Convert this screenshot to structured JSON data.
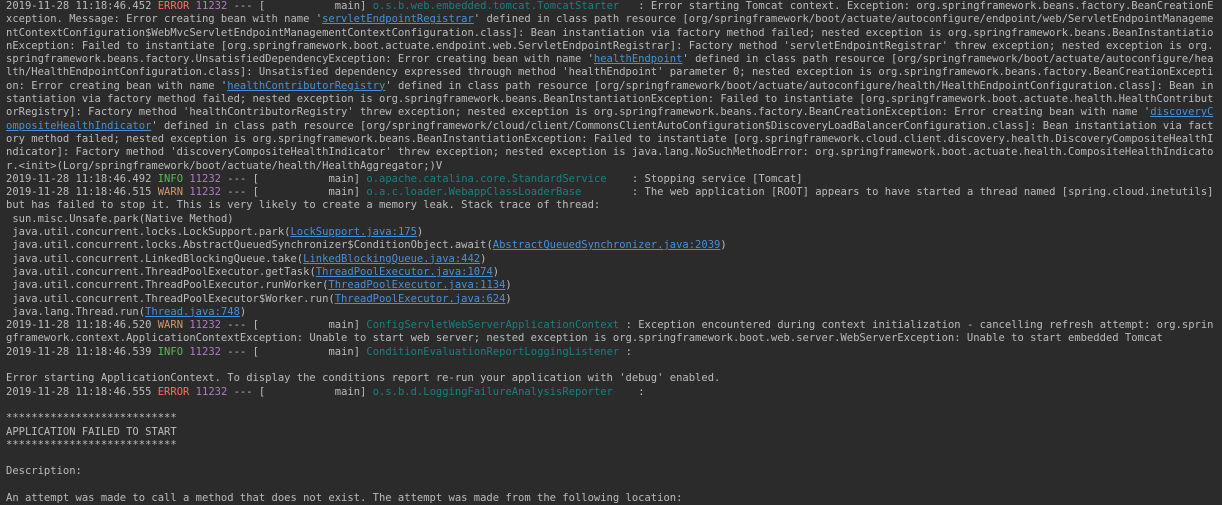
{
  "lines": [
    {
      "type": "log",
      "ts": "2019-11-28 11:18:46.452",
      "level": "ERROR",
      "pid": "11232",
      "sep": "---",
      "thread": "[           main]",
      "logger": "o.s.b.web.embedded.tomcat.TomcatStarter  ",
      "msg": [
        {
          "t": " : Error starting Tomcat context. Exception: org.springframework.beans.factory.BeanCreationException. Message: Error creating bean with name '"
        },
        {
          "t": "servletEndpointRegistrar",
          "link": true
        },
        {
          "t": "' defined in class path resource [org/springframework/boot/actuate/autoconfigure/endpoint/web/ServletEndpointManagementContextConfiguration$WebMvcServletEndpointManagementContextConfiguration.class]: Bean instantiation via factory method failed; nested exception is org.springframework.beans.BeanInstantiationException: Failed to instantiate [org.springframework.boot.actuate.endpoint.web.ServletEndpointRegistrar]: Factory method 'servletEndpointRegistrar' threw exception; nested exception is org.springframework.beans.factory.UnsatisfiedDependencyException: Error creating bean with name '"
        },
        {
          "t": "healthEndpoint",
          "link": true
        },
        {
          "t": "' defined in class path resource [org/springframework/boot/actuate/autoconfigure/health/HealthEndpointConfiguration.class]: Unsatisfied dependency expressed through method 'healthEndpoint' parameter 0; nested exception is org.springframework.beans.factory.BeanCreationException: Error creating bean with name '"
        },
        {
          "t": "healthContributorRegistry",
          "link": true
        },
        {
          "t": "' defined in class path resource [org/springframework/boot/actuate/autoconfigure/health/HealthEndpointConfiguration.class]: Bean instantiation via factory method failed; nested exception is org.springframework.beans.BeanInstantiationException: Failed to instantiate [org.springframework.boot.actuate.health.HealthContributorRegistry]: Factory method 'healthContributorRegistry' threw exception; nested exception is org.springframework.beans.factory.BeanCreationException: Error creating bean with name '"
        },
        {
          "t": "discoveryCompositeHealthIndicator",
          "link": true
        },
        {
          "t": "' defined in class path resource [org/springframework/cloud/client/CommonsClientAutoConfiguration$DiscoveryLoadBalancerConfiguration.class]: Bean instantiation via factory method failed; nested exception is org.springframework.beans.BeanInstantiationException: Failed to instantiate [org.springframework.cloud.client.discovery.health.DiscoveryCompositeHealthIndicator]: Factory method 'discoveryCompositeHealthIndicator' threw exception; nested exception is java.lang.NoSuchMethodError: org.springframework.boot.actuate.health.CompositeHealthIndicator.<init>(Lorg/springframework/boot/actuate/health/HealthAggregator;)V"
        }
      ]
    },
    {
      "type": "log",
      "ts": "2019-11-28 11:18:46.492",
      "level": "INFO",
      "pid": "11232",
      "sep": "---",
      "thread": "[           main]",
      "logger": "o.apache.catalina.core.StandardService   ",
      "msg": [
        {
          "t": " : Stopping service [Tomcat]"
        }
      ]
    },
    {
      "type": "log",
      "ts": "2019-11-28 11:18:46.515",
      "level": "WARN",
      "pid": "11232",
      "sep": "---",
      "thread": "[           main]",
      "logger": "o.a.c.loader.WebappClassLoaderBase       ",
      "msg": [
        {
          "t": " : The web application [ROOT] appears to have started a thread named [spring.cloud.inetutils] but has failed to stop it. This is very likely to create a memory leak. Stack trace of thread:"
        }
      ]
    },
    {
      "type": "text",
      "msg": [
        {
          "t": " sun.misc.Unsafe.park(Native Method)"
        }
      ]
    },
    {
      "type": "text",
      "msg": [
        {
          "t": " java.util.concurrent.locks.LockSupport.park("
        },
        {
          "t": "LockSupport.java:175",
          "link": true
        },
        {
          "t": ")"
        }
      ]
    },
    {
      "type": "text",
      "msg": [
        {
          "t": " java.util.concurrent.locks.AbstractQueuedSynchronizer$ConditionObject.await("
        },
        {
          "t": "AbstractQueuedSynchronizer.java:2039",
          "link": true
        },
        {
          "t": ")"
        }
      ]
    },
    {
      "type": "text",
      "msg": [
        {
          "t": " java.util.concurrent.LinkedBlockingQueue.take("
        },
        {
          "t": "LinkedBlockingQueue.java:442",
          "link": true
        },
        {
          "t": ")"
        }
      ]
    },
    {
      "type": "text",
      "msg": [
        {
          "t": " java.util.concurrent.ThreadPoolExecutor.getTask("
        },
        {
          "t": "ThreadPoolExecutor.java:1074",
          "link": true
        },
        {
          "t": ")"
        }
      ]
    },
    {
      "type": "text",
      "msg": [
        {
          "t": " java.util.concurrent.ThreadPoolExecutor.runWorker("
        },
        {
          "t": "ThreadPoolExecutor.java:1134",
          "link": true
        },
        {
          "t": ")"
        }
      ]
    },
    {
      "type": "text",
      "msg": [
        {
          "t": " java.util.concurrent.ThreadPoolExecutor$Worker.run("
        },
        {
          "t": "ThreadPoolExecutor.java:624",
          "link": true
        },
        {
          "t": ")"
        }
      ]
    },
    {
      "type": "text",
      "msg": [
        {
          "t": " java.lang.Thread.run("
        },
        {
          "t": "Thread.java:748",
          "link": true
        },
        {
          "t": ")"
        }
      ]
    },
    {
      "type": "log",
      "ts": "2019-11-28 11:18:46.520",
      "level": "WARN",
      "pid": "11232",
      "sep": "---",
      "thread": "[           main]",
      "logger": "ConfigServletWebServerApplicationContext",
      "msg": [
        {
          "t": " : Exception encountered during context initialization - cancelling refresh attempt: org.springframework.context.ApplicationContextException: Unable to start web server; nested exception is org.springframework.boot.web.server.WebServerException: Unable to start embedded Tomcat"
        }
      ]
    },
    {
      "type": "log",
      "ts": "2019-11-28 11:18:46.539",
      "level": "INFO",
      "pid": "11232",
      "sep": "---",
      "thread": "[           main]",
      "logger": "ConditionEvaluationReportLoggingListener",
      "msg": [
        {
          "t": " :"
        }
      ]
    },
    {
      "type": "text",
      "msg": [
        {
          "t": ""
        }
      ]
    },
    {
      "type": "text",
      "msg": [
        {
          "t": "Error starting ApplicationContext. To display the conditions report re-run your application with 'debug' enabled."
        }
      ]
    },
    {
      "type": "log",
      "ts": "2019-11-28 11:18:46.555",
      "level": "ERROR",
      "pid": "11232",
      "sep": "---",
      "thread": "[           main]",
      "logger": "o.s.b.d.LoggingFailureAnalysisReporter   ",
      "msg": [
        {
          "t": " :"
        }
      ]
    },
    {
      "type": "text",
      "msg": [
        {
          "t": ""
        }
      ]
    },
    {
      "type": "text",
      "msg": [
        {
          "t": "***************************"
        }
      ]
    },
    {
      "type": "text",
      "msg": [
        {
          "t": "APPLICATION FAILED TO START"
        }
      ]
    },
    {
      "type": "text",
      "msg": [
        {
          "t": "***************************"
        }
      ]
    },
    {
      "type": "text",
      "msg": [
        {
          "t": ""
        }
      ]
    },
    {
      "type": "text",
      "msg": [
        {
          "t": "Description:"
        }
      ]
    },
    {
      "type": "text",
      "msg": [
        {
          "t": ""
        }
      ]
    },
    {
      "type": "text",
      "msg": [
        {
          "t": "An attempt was made to call a method that does not exist. The attempt was made from the following location:"
        }
      ]
    }
  ]
}
